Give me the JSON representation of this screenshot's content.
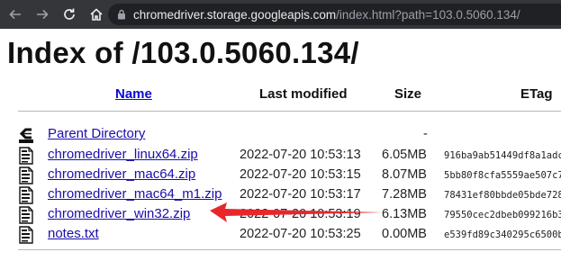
{
  "browser": {
    "url_host": "chromedriver.storage.googleapis.com",
    "url_path": "/index.html?path=103.0.5060.134/"
  },
  "page": {
    "title": "Index of /103.0.5060.134/"
  },
  "table": {
    "headers": {
      "name": "Name",
      "last_modified": "Last modified",
      "size": "Size",
      "etag": "ETag"
    },
    "parent": {
      "name": "Parent Directory",
      "size": "-"
    },
    "rows": [
      {
        "name": "chromedriver_linux64.zip",
        "date": "2022-07-20 10:53:13",
        "size": "6.05MB",
        "etag": "916ba9ab51449df8a1adc"
      },
      {
        "name": "chromedriver_mac64.zip",
        "date": "2022-07-20 10:53:15",
        "size": "8.07MB",
        "etag": "5bb80f8cfa5559ae507c7"
      },
      {
        "name": "chromedriver_mac64_m1.zip",
        "date": "2022-07-20 10:53:17",
        "size": "7.28MB",
        "etag": "78431ef80bbde05bde728"
      },
      {
        "name": "chromedriver_win32.zip",
        "date": "2022-07-20 10:53:19",
        "size": "6.13MB",
        "etag": "79550cec2dbeb099216b3"
      },
      {
        "name": "notes.txt",
        "date": "2022-07-20 10:53:25",
        "size": "0.00MB",
        "etag": "e539fd89c340295c6500b"
      }
    ]
  },
  "annotation": {
    "arrow_color": "#e8262b",
    "points_to": "chromedriver_win32.zip"
  }
}
